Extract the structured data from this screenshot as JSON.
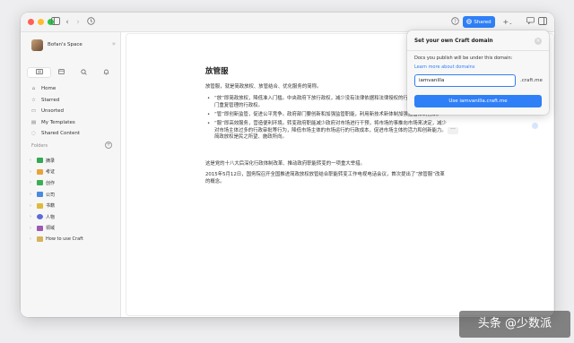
{
  "titlebar": {
    "shared_label": "Shared",
    "plus_label": "+"
  },
  "sidebar": {
    "space_name": "Bofan's Space",
    "nav": [
      {
        "label": "Home",
        "icon": "home-icon"
      },
      {
        "label": "Starred",
        "icon": "star-icon"
      },
      {
        "label": "Unsorted",
        "icon": "inbox-icon"
      },
      {
        "label": "My Templates",
        "icon": "template-icon"
      },
      {
        "label": "Shared Content",
        "icon": "share-icon"
      }
    ],
    "folders_label": "Folders",
    "folders": [
      {
        "label": "摘录",
        "color": "#34a853"
      },
      {
        "label": "考证",
        "color": "#e8a33a"
      },
      {
        "label": "创作",
        "color": "#3cae57"
      },
      {
        "label": "公司",
        "color": "#4a8be0"
      },
      {
        "label": "书籍",
        "color": "#e0b93a"
      },
      {
        "label": "人物",
        "color": "#5b6bd6"
      },
      {
        "label": "领域",
        "color": "#9b59b6"
      },
      {
        "label": "How to use Craft",
        "color": "#d7b25a"
      }
    ]
  },
  "document": {
    "title": "放管服",
    "intro": "放管服，就是简政放权、放管结合、优化服务的简称。",
    "bullets": [
      "“放”即简政放权，降低准入门槛。中央政府下放行政权，减少没有法律依据和法律授权的行政权；理清多个部门重复管理的行政权。",
      "“管”即创新监管，促进公平竞争。政府部门要创新和加强监管职能，利用新技术新体制加强监管体制创新。",
      "“服”即高效服务，营造便利环境。转变政府职能减少政府对市场进行干预，将市场的事推向市场来决定，减少对市场主体过多的行政审批等行为，降低市场主体的市场运行的行政成本，促进市场主体的活力和创新能力。简政放权是民之所望、施政所向。"
    ],
    "para2": "这是党的十八大后深化行政体制改革、推动政府职能转变的一项重大举措。",
    "para3": "2015年5月12日，国务院召开全国推进简政放权放管结合职能转变工作电视电话会议，首次提出了“放管服”改革的概念。"
  },
  "popover": {
    "title": "Set your own Craft domain",
    "description": "Docs you publish will be under this domain:",
    "link": "Learn more about domains",
    "input_value": "iamvanilla",
    "suffix": ".craft.me",
    "button": "Use iamvanilla.craft.me"
  },
  "watermark": "头条 @少数派"
}
